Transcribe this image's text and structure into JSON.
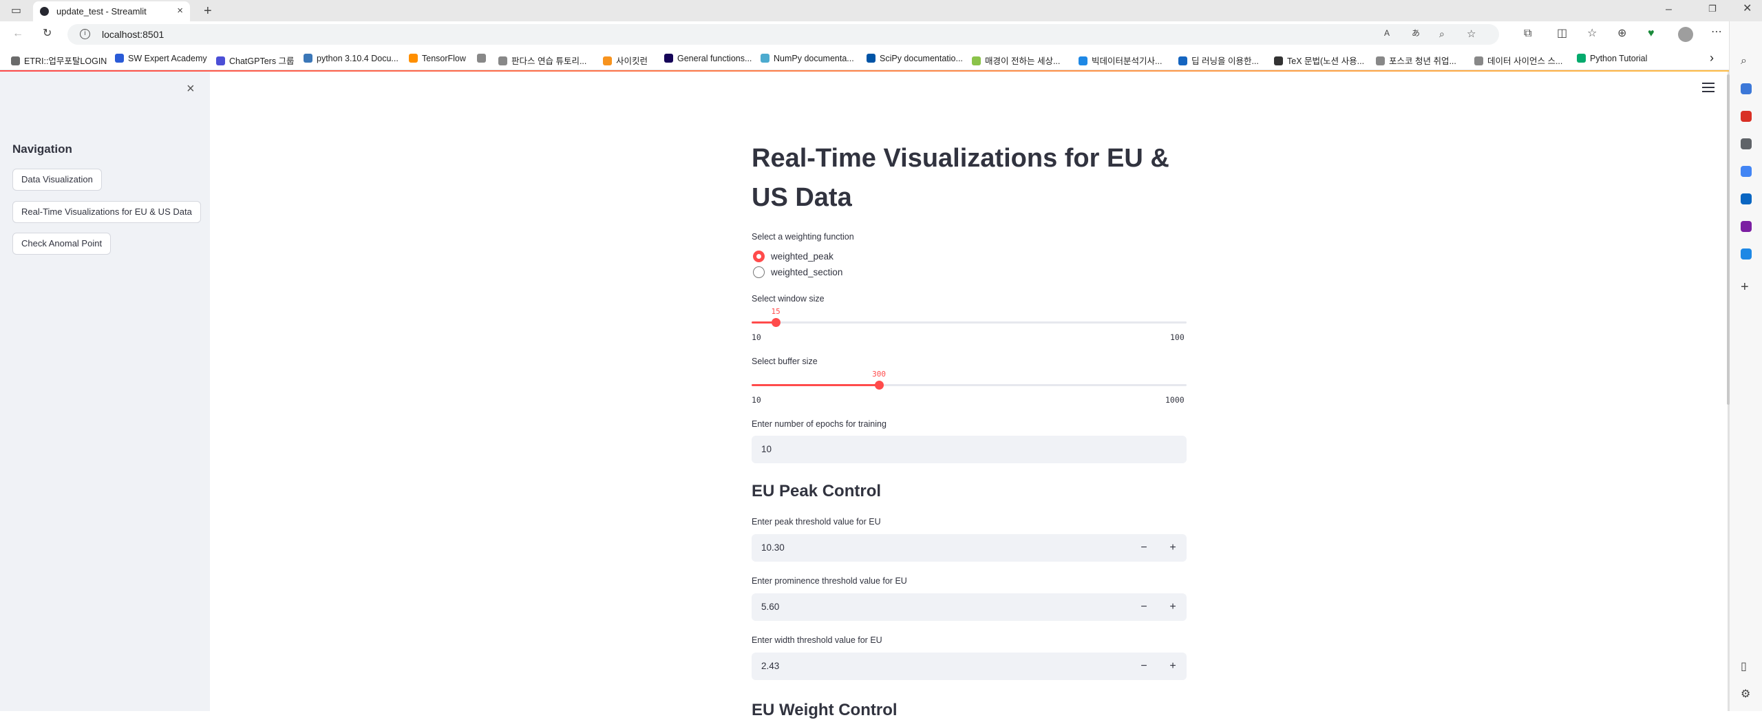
{
  "browser": {
    "tab_title": "update_test - Streamlit",
    "tab_close": "×",
    "new_tab": "+",
    "url": "localhost:8501",
    "bookmarks": [
      {
        "label": "ETRI::업무포탈LOGIN",
        "color": "#6b6b6b"
      },
      {
        "label": "SW Expert Academy",
        "color": "#2a5bd7"
      },
      {
        "label": "ChatGPTers 그룹",
        "color": "#4b4fd6"
      },
      {
        "label": "python 3.10.4 Docu...",
        "color": "#3b77b8"
      },
      {
        "label": "TensorFlow",
        "color": "#ff8f00"
      },
      {
        "label": "",
        "color": "#888888"
      },
      {
        "label": "판다스 연습 튜토리...",
        "color": "#888888"
      },
      {
        "label": "사이킷런",
        "color": "#f7931e"
      },
      {
        "label": "General functions...",
        "color": "#150458"
      },
      {
        "label": "NumPy documenta...",
        "color": "#4dabcf"
      },
      {
        "label": "SciPy documentatio...",
        "color": "#0054a6"
      },
      {
        "label": "매경이 전하는 세상...",
        "color": "#8bc34a"
      },
      {
        "label": "빅데이터분석기사...",
        "color": "#1e88e5"
      },
      {
        "label": "딥 러닝을 이용한...",
        "color": "#1565c0"
      },
      {
        "label": "TeX 문법(노션 사용...",
        "color": "#333333"
      },
      {
        "label": "포스코 청년 취업...",
        "color": "#888888"
      },
      {
        "label": "데이터 사이언스 스...",
        "color": "#888888"
      },
      {
        "label": "Python Tutorial",
        "color": "#04aa6d"
      }
    ],
    "bookmarks_more": "›"
  },
  "sidebar": {
    "close": "×",
    "heading": "Navigation",
    "buttons": [
      "Data Visualization",
      "Real-Time Visualizations for EU & US Data",
      "Check Anomal Point"
    ]
  },
  "main": {
    "title": "Real-Time Visualizations for EU & US Data",
    "weighting": {
      "label": "Select a weighting function",
      "options": [
        "weighted_peak",
        "weighted_section"
      ],
      "selected": "weighted_peak"
    },
    "window_size": {
      "label": "Select window size",
      "value": "15",
      "min": "10",
      "max": "100",
      "fraction": 0.0556
    },
    "buffer_size": {
      "label": "Select buffer size",
      "value": "300",
      "min": "10",
      "max": "1000",
      "fraction": 0.2929
    },
    "epochs": {
      "label": "Enter number of epochs for training",
      "value": "10"
    },
    "eu_peak": {
      "heading": "EU Peak Control",
      "peak": {
        "label": "Enter peak threshold value for EU",
        "value": "10.30"
      },
      "prominence": {
        "label": "Enter prominence threshold value for EU",
        "value": "5.60"
      },
      "width": {
        "label": "Enter width threshold value for EU",
        "value": "2.43"
      }
    },
    "stepper": {
      "minus": "−",
      "plus": "+"
    },
    "next_heading": "EU Weight Control"
  }
}
